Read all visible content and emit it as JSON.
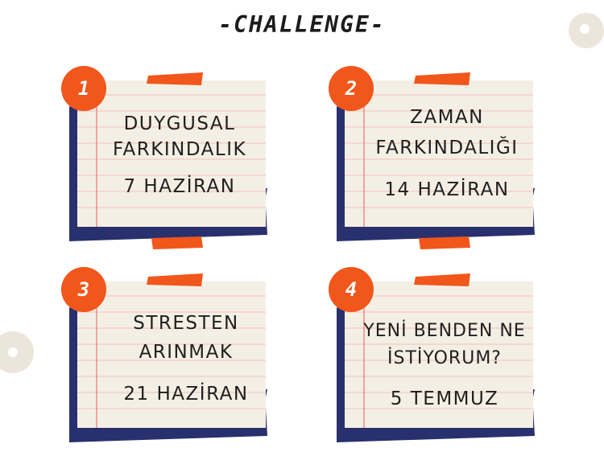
{
  "title": "-CHALLENGE-",
  "colors": {
    "accent": "#f1561b",
    "navy": "#28306e",
    "paper": "#f4efe4",
    "line": "#f2c2bd",
    "margin": "#ea8d86",
    "deco": "#ece5dc"
  },
  "cards": [
    {
      "number": "1",
      "line1": "DUYGUSAL",
      "line2": "FARKINDALIK",
      "date": "7 HAZİRAN"
    },
    {
      "number": "2",
      "line1": "ZAMAN",
      "line2": "FARKINDALIĞI",
      "date": "14 HAZİRAN"
    },
    {
      "number": "3",
      "line1": "STRESTEN",
      "line2": "ARINMAK",
      "date": "21 HAZİRAN"
    },
    {
      "number": "4",
      "line1": "YENİ BENDEN NE",
      "line2": "İSTİYORUM?",
      "date": "5 TEMMUZ"
    }
  ]
}
